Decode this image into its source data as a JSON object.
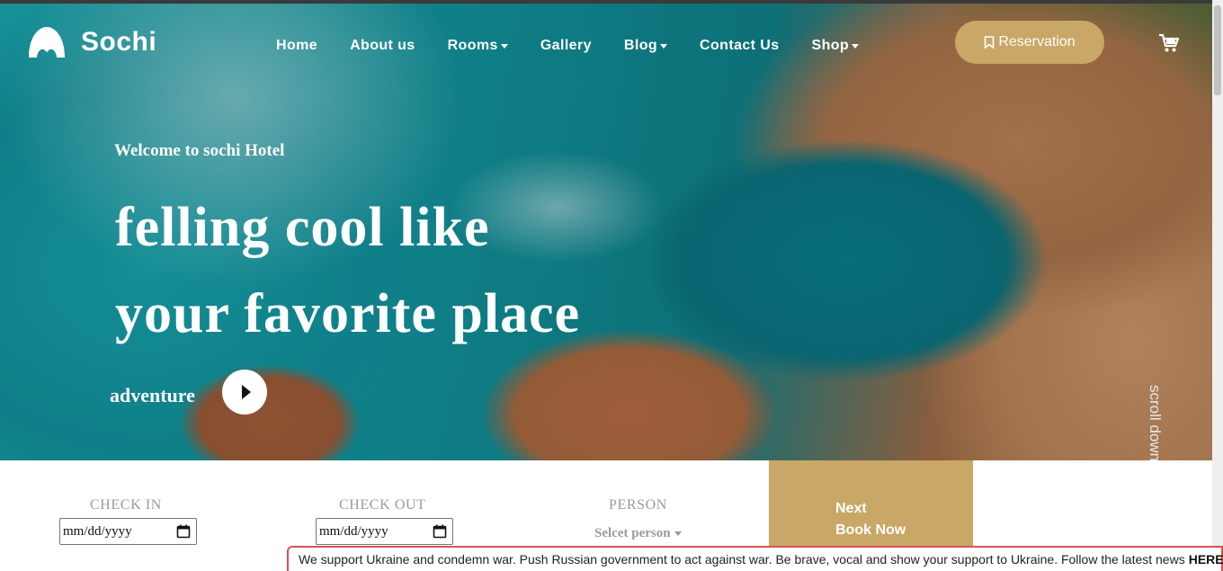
{
  "brand": {
    "name": "Sochi",
    "logo_icon": "mountain-logo-icon"
  },
  "nav": {
    "items": [
      {
        "label": "Home",
        "dropdown": false
      },
      {
        "label": "About us",
        "dropdown": false
      },
      {
        "label": "Rooms",
        "dropdown": true
      },
      {
        "label": "Gallery",
        "dropdown": false
      },
      {
        "label": "Blog",
        "dropdown": true
      },
      {
        "label": "Contact Us",
        "dropdown": false
      },
      {
        "label": "Shop",
        "dropdown": true
      }
    ],
    "reservation_label": "Reservation",
    "reservation_icon": "bookmark-icon",
    "cart_icon": "cart-icon"
  },
  "hero": {
    "welcome": "Welcome to sochi Hotel",
    "headline_line1": "felling cool like",
    "headline_line2": "your favorite place",
    "adventure": "adventure",
    "play_icon": "play-icon",
    "scroll_down": "scroll down",
    "scroll_icon": "pointing-hand-icon"
  },
  "booking": {
    "check_in_label": "CHECK IN",
    "check_in_value": "mm/dd/yyyy",
    "check_out_label": "CHECK OUT",
    "check_out_value": "mm/dd/yyyy",
    "person_label": "PERSON",
    "person_value": "Selcet person",
    "next_line1": "Next",
    "next_line2": "Book Now"
  },
  "banner": {
    "text": "We support Ukraine and condemn war. Push Russian government to act against war. Be brave, vocal and show your support to Ukraine. Follow the latest news",
    "link": "HERE"
  },
  "colors": {
    "accent": "#c9a766",
    "banner_border": "#d9534f",
    "label_gray": "#9a9a9a"
  }
}
